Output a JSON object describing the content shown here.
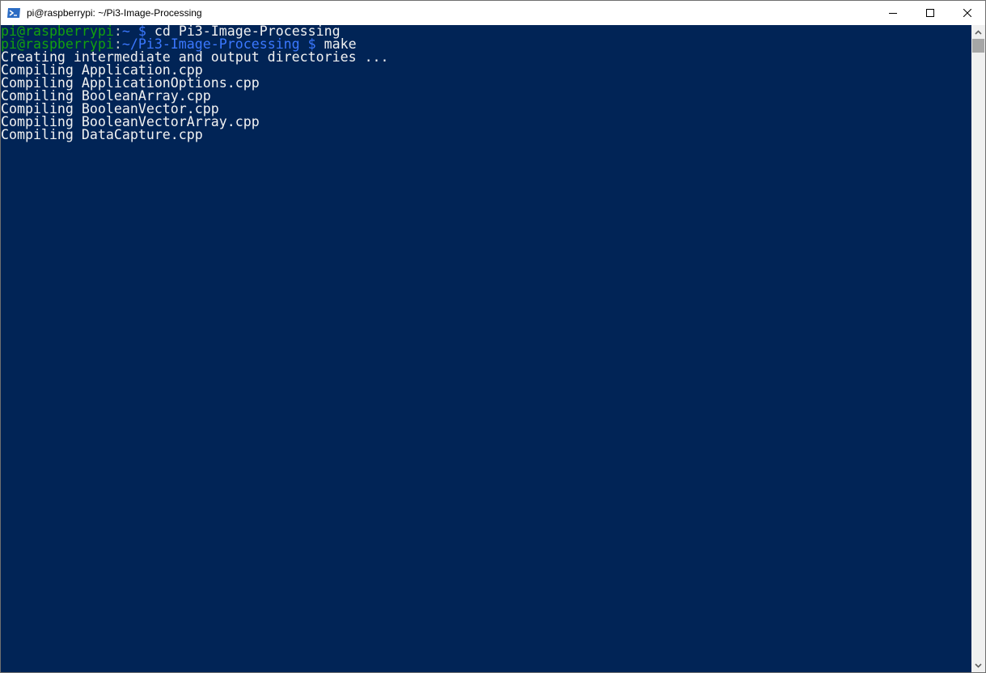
{
  "window": {
    "title": "pi@raspberrypi: ~/Pi3-Image-Processing",
    "icon": "powershell-icon",
    "controls": [
      "minimize",
      "maximize",
      "close"
    ]
  },
  "colors": {
    "background": "#012456",
    "prompt_user": "#13a10e",
    "prompt_path": "#3b78ff",
    "text": "#cccccc"
  },
  "terminal": {
    "prompts": [
      {
        "user_host": "pi@raspberrypi",
        "sep": ":",
        "path": "~",
        "symbol": " $ ",
        "command": "cd Pi3-Image-Processing"
      },
      {
        "user_host": "pi@raspberrypi",
        "sep": ":",
        "path": "~/Pi3-Image-Processing",
        "symbol": " $ ",
        "command": "make"
      }
    ],
    "output": [
      "Creating intermediate and output directories ...",
      "Compiling Application.cpp",
      "Compiling ApplicationOptions.cpp",
      "Compiling BooleanArray.cpp",
      "Compiling BooleanVector.cpp",
      "Compiling BooleanVectorArray.cpp",
      "Compiling DataCapture.cpp"
    ]
  }
}
